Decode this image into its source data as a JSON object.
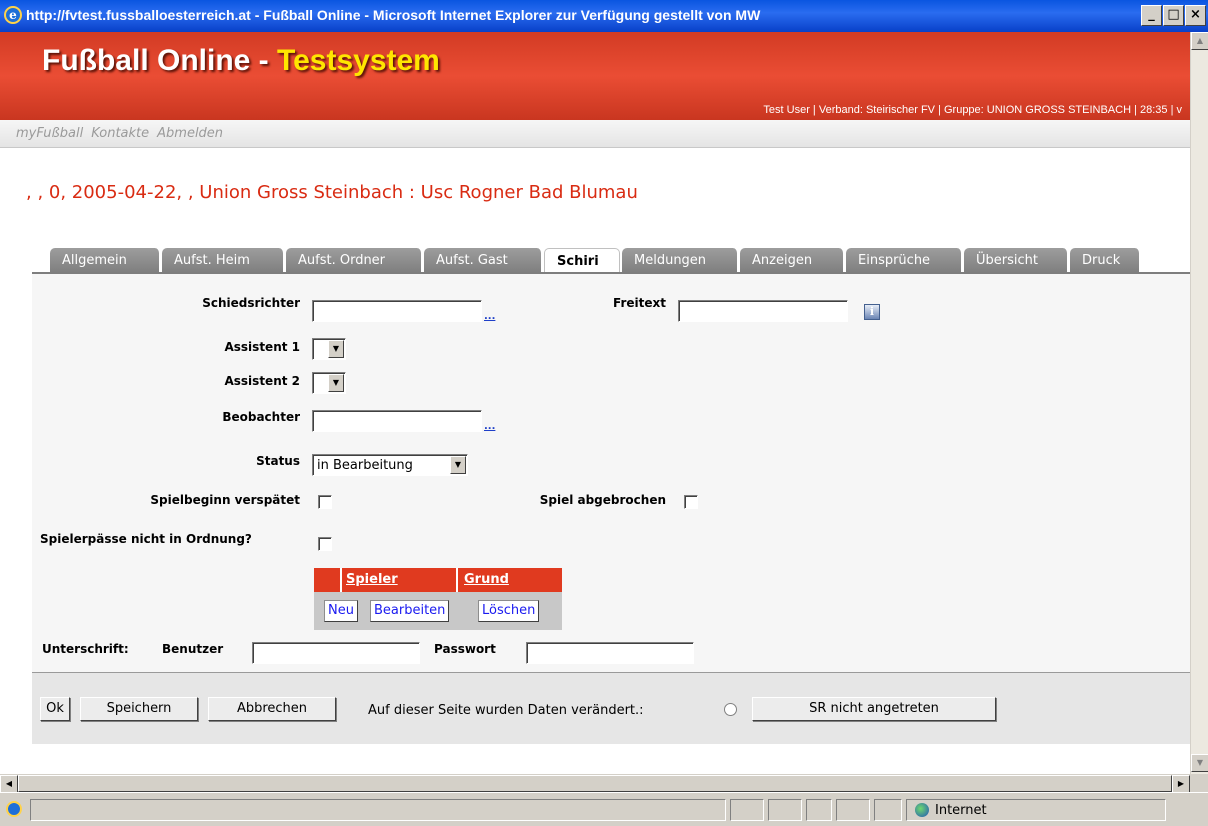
{
  "window": {
    "title": "http://fvtest.fussballoesterreich.at - Fußball Online - Microsoft Internet Explorer  zur Verfügung gestellt von MW",
    "minimize": "_",
    "maximize": "□",
    "close": "×"
  },
  "header": {
    "brand_main": "Fußball Online - ",
    "brand_accent": "Testsystem",
    "user_info": "Test User | Verband: Steirischer FV | Gruppe: UNION GROSS STEINBACH | 28:35 | v"
  },
  "nav": [
    "myFußball",
    "Kontakte",
    "Abmelden"
  ],
  "page_title": ", , 0, 2005-04-22, , Union Gross Steinbach : Usc Rogner Bad Blumau",
  "tabs": [
    {
      "label": "Allgemein",
      "active": false
    },
    {
      "label": "Aufst. Heim",
      "active": false
    },
    {
      "label": "Aufst. Ordner",
      "active": false
    },
    {
      "label": "Aufst. Gast",
      "active": false
    },
    {
      "label": "Schiri",
      "active": true
    },
    {
      "label": "Meldungen",
      "active": false
    },
    {
      "label": "Anzeigen",
      "active": false
    },
    {
      "label": "Einsprüche",
      "active": false
    },
    {
      "label": "Übersicht",
      "active": false
    },
    {
      "label": "Druck",
      "active": false
    }
  ],
  "form": {
    "schiedsrichter_label": "Schiedsrichter",
    "schiedsrichter_value": "",
    "freitext_label": "Freitext",
    "freitext_value": "",
    "ellipsis": "...",
    "info_icon_text": "i",
    "assistent1_label": "Assistent 1",
    "assistent2_label": "Assistent 2",
    "beobachter_label": "Beobachter",
    "beobachter_value": "",
    "status_label": "Status",
    "status_value": "in Bearbeitung",
    "spielbeginn_label": "Spielbeginn verspätet",
    "spiel_abgebrochen_label": "Spiel abgebrochen",
    "spielerpaesse_label": "Spielerpässe nicht in Ordnung?",
    "spielbeginn_checked": false,
    "spiel_abgebrochen_checked": false,
    "spielerpaesse_checked": false
  },
  "player_table": {
    "columns": [
      "Spieler",
      "Grund"
    ],
    "buttons": [
      "Neu",
      "Bearbeiten",
      "Löschen"
    ]
  },
  "signature": {
    "label": "Unterschrift:",
    "benutzer_label": "Benutzer",
    "benutzer_value": "",
    "passwort_label": "Passwort",
    "passwort_value": ""
  },
  "footer": {
    "ok": "Ok",
    "speichern": "Speichern",
    "abbrechen": "Abbrechen",
    "changed_text": "Auf dieser Seite wurden Daten verändert.:",
    "sr_button": "SR nicht angetreten"
  },
  "statusbar": {
    "zone": "Internet"
  },
  "colors": {
    "header_red": "#e34a31",
    "accent_yellow": "#ffe600",
    "title_red": "#d92b12",
    "tab_gray": "#8e8e8e",
    "table_header_red": "#e03a1f"
  }
}
